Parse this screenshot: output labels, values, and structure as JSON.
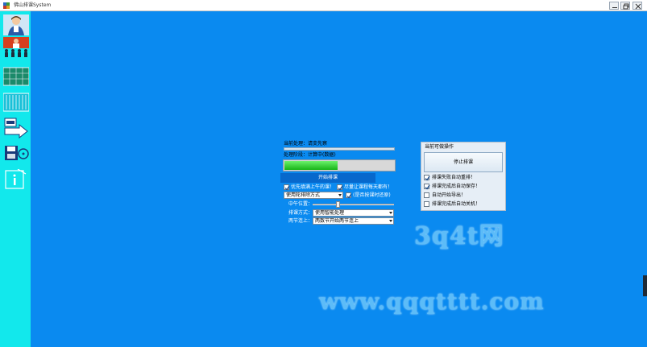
{
  "window": {
    "title": "佛山排课System"
  },
  "sidebar": {
    "items": [
      {
        "name": "teacher"
      },
      {
        "name": "class-teacher"
      },
      {
        "name": "classes"
      },
      {
        "name": "schedule-grid"
      },
      {
        "name": "export"
      },
      {
        "name": "save-disk"
      },
      {
        "name": "info"
      }
    ]
  },
  "main": {
    "status_label": "当前处理：请支先察",
    "processing_label": "处理阶段：计算中(数据)",
    "progress_percent": 48,
    "start_button": "开始排课",
    "check1_label": "优先填满上午的课！",
    "check2_label": "尽量让课程每天都有！",
    "select_method": "使用轮排除方式",
    "check3_label": "(是否按课时还原)",
    "middle_position_label": "中午位置：",
    "sort_mode_label": "排课方式：",
    "sort_mode_value": "使用智能处理",
    "connect_label": "两节连上：",
    "connect_value": "两数节开始两节连上",
    "slider_value": 0.3
  },
  "panel": {
    "title": "当前可做操作",
    "stop_button": "停止排课",
    "options": [
      {
        "label": "排课失败自动重排！",
        "checked": true
      },
      {
        "label": "排课完成后自动保存！",
        "checked": true
      },
      {
        "label": "自动开始导出！",
        "checked": false
      },
      {
        "label": "排课完成后自动关机！",
        "checked": false
      }
    ]
  },
  "watermark": {
    "line1": "3q4t网",
    "line2": "www.qqqtttt.com"
  },
  "colors": {
    "background": "#0a8af0",
    "sidebar": "#12e8ec",
    "progress": "#16b416",
    "button": "#0768cc"
  }
}
